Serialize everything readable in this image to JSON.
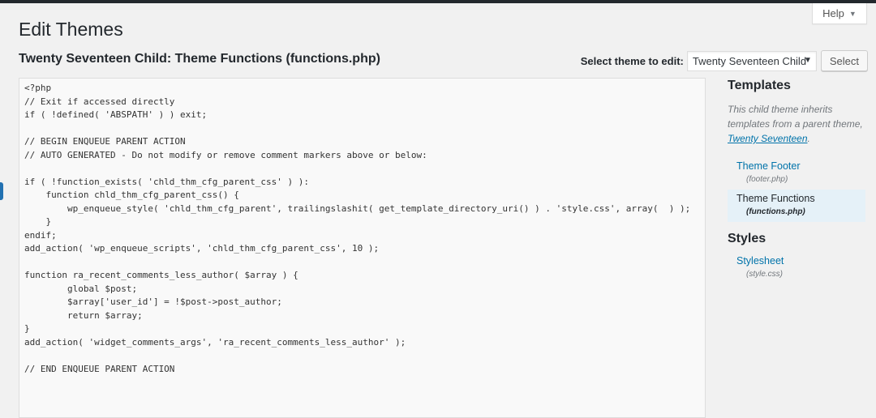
{
  "help": {
    "label": "Help",
    "caret": "▼"
  },
  "page": {
    "title": "Edit Themes",
    "file_title": "Twenty Seventeen Child: Theme Functions (functions.php)"
  },
  "theme_select": {
    "label": "Select theme to edit:",
    "value": "Twenty Seventeen Child",
    "caret": "▼",
    "button": "Select"
  },
  "editor": {
    "lines": [
      "<?php",
      "// Exit if accessed directly",
      "if ( !defined( 'ABSPATH' ) ) exit;",
      "",
      "// BEGIN ENQUEUE PARENT ACTION",
      "// AUTO GENERATED - Do not modify or remove comment markers above or below:",
      "",
      "if ( !function_exists( 'chld_thm_cfg_parent_css' ) ):",
      "    function chld_thm_cfg_parent_css() {",
      "        wp_enqueue_style( 'chld_thm_cfg_parent', trailingslashit( get_template_directory_uri() ) . 'style.css', array(  ) );",
      "    }",
      "endif;",
      "add_action( 'wp_enqueue_scripts', 'chld_thm_cfg_parent_css', 10 );",
      "",
      "function ra_recent_comments_less_author( $array ) {",
      "        global $post;",
      "        $array['user_id'] = !$post->post_author;",
      "        return $array;",
      "}",
      "add_action( 'widget_comments_args', 'ra_recent_comments_less_author' );",
      "",
      "// END ENQUEUE PARENT ACTION"
    ]
  },
  "sidebar": {
    "templates_heading": "Templates",
    "description": "This child theme inherits templates from a parent theme,",
    "parent_theme_link": "Twenty Seventeen",
    "description_end": ".",
    "templates": [
      {
        "name": "Theme Footer",
        "file": "(footer.php)"
      },
      {
        "name": "Theme Functions",
        "file": "(functions.php)"
      }
    ],
    "styles_heading": "Styles",
    "styles": [
      {
        "name": "Stylesheet",
        "file": "(style.css)"
      }
    ]
  }
}
